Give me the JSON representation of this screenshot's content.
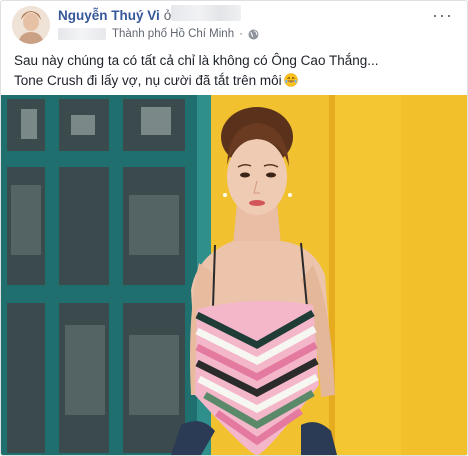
{
  "post": {
    "author": "Nguyễn Thuý Vi",
    "connector": "ở",
    "location": "Thành phố Hồ Chí Minh",
    "separator": "·",
    "text_line1": "Sau này chúng ta có tất cả chỉ là không có Ông Cao Thắng...",
    "text_line2": "Tone Crush đi lấy vợ, nụ cười đã tắt trên môi",
    "more_label": "···"
  },
  "icons": {
    "privacy": "globe-icon",
    "menu": "more-options-icon",
    "emoji": "laughing-emoji-icon"
  },
  "colors": {
    "author_link": "#365899",
    "wall_yellow": "#f2c12e",
    "window_teal": "#2c8a86"
  }
}
